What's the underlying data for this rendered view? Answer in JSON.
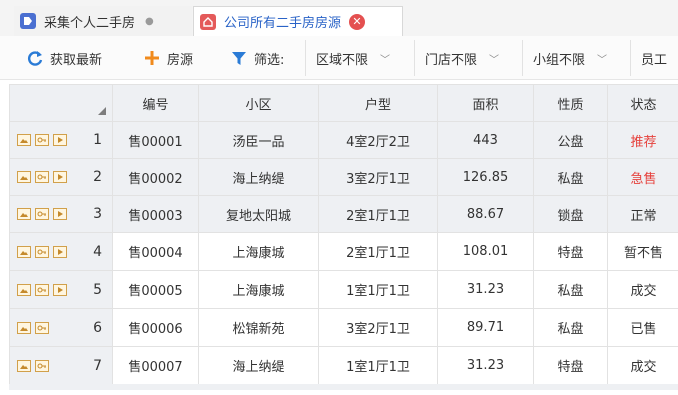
{
  "tabs": [
    {
      "label": "采集个人二手房",
      "icon": "tag-icon",
      "active": false
    },
    {
      "label": "公司所有二手房房源",
      "icon": "home-icon",
      "active": true
    }
  ],
  "toolbar": {
    "refresh_label": "获取最新",
    "add_label": "房源",
    "filter_label": "筛选:",
    "filters": [
      {
        "label": "区域不限"
      },
      {
        "label": "门店不限"
      },
      {
        "label": "小组不限"
      },
      {
        "label": "员工"
      }
    ]
  },
  "table": {
    "columns": [
      "编号",
      "小区",
      "户型",
      "面积",
      "性质",
      "状态"
    ],
    "rows": [
      {
        "n": "1",
        "id": "售00001",
        "community": "汤臣一品",
        "layout": "4室2厅2卫",
        "area": "443",
        "type": "公盘",
        "status": "推荐"
      },
      {
        "n": "2",
        "id": "售00002",
        "community": "海上纳缇",
        "layout": "3室2厅1卫",
        "area": "126.85",
        "type": "私盘",
        "status": "急售"
      },
      {
        "n": "3",
        "id": "售00003",
        "community": "复地太阳城",
        "layout": "2室1厅1卫",
        "area": "88.67",
        "type": "锁盘",
        "status": "正常"
      },
      {
        "n": "4",
        "id": "售00004",
        "community": "上海康城",
        "layout": "2室1厅1卫",
        "area": "108.01",
        "type": "特盘",
        "status": "暂不售"
      },
      {
        "n": "5",
        "id": "售00005",
        "community": "上海康城",
        "layout": "1室1厅1卫",
        "area": "31.23",
        "type": "私盘",
        "status": "成交"
      },
      {
        "n": "6",
        "id": "售00006",
        "community": "松锦新苑",
        "layout": "3室2厅1卫",
        "area": "89.71",
        "type": "私盘",
        "status": "已售"
      },
      {
        "n": "7",
        "id": "售00007",
        "community": "海上纳缇",
        "layout": "1室1厅1卫",
        "area": "31.23",
        "type": "特盘",
        "status": "成交"
      }
    ]
  },
  "colors": {
    "accent_blue": "#2a63c7",
    "status_red": "#e6413c",
    "header_bg": "#eef0f3"
  }
}
